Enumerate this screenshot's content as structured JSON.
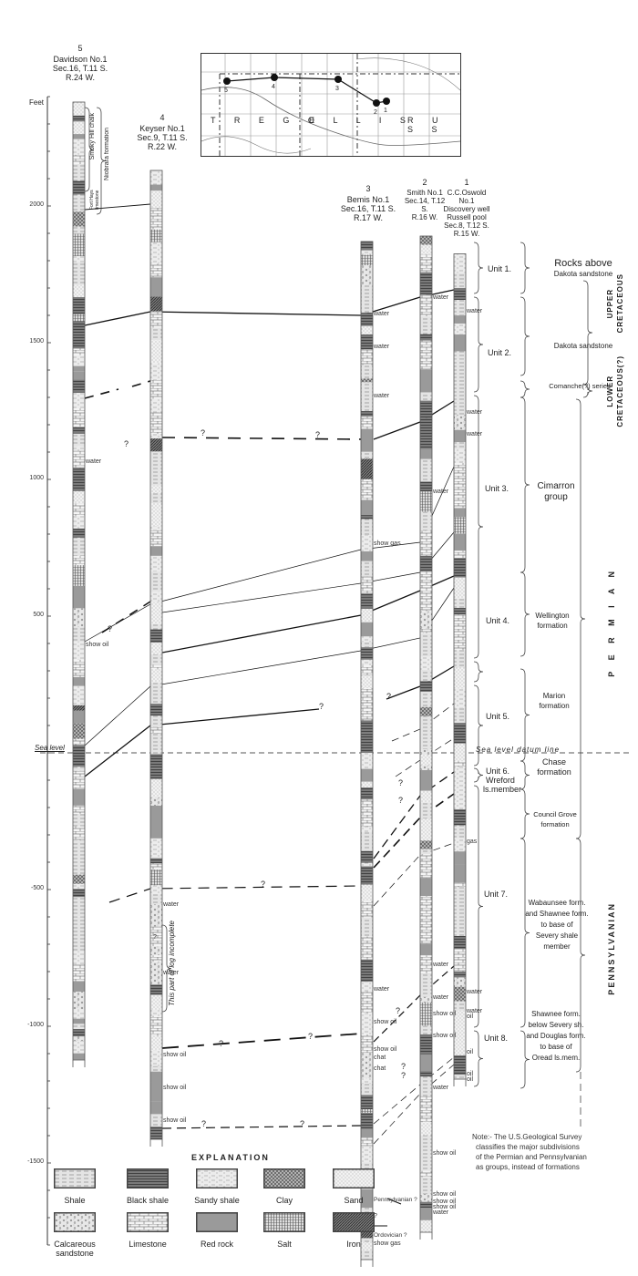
{
  "axis": {
    "unit_label": "Feet",
    "ticks": [
      {
        "value": 2000,
        "label": "2000"
      },
      {
        "value": 1500,
        "label": "1500"
      },
      {
        "value": 1000,
        "label": "1000"
      },
      {
        "value": 500,
        "label": "500"
      },
      {
        "value": 0,
        "label": "Sea level"
      },
      {
        "value": -500,
        "label": "-500"
      },
      {
        "value": -1000,
        "label": "-1000"
      },
      {
        "value": -1500,
        "label": "-1500"
      }
    ],
    "minor_step": 100
  },
  "datum": {
    "label": "Sea level datum line"
  },
  "wells": [
    {
      "id": "5",
      "name": "Davidson No.1",
      "lines": [
        "Sec.16, T.11 S.",
        "R.24 W."
      ],
      "top_ft": 2380,
      "bottom_ft": -1150
    },
    {
      "id": "4",
      "name": "Keyser No.1",
      "lines": [
        "Sec.9, T.11 S.",
        "R.22 W."
      ],
      "top_ft": 2130,
      "bottom_ft": -1440
    },
    {
      "id": "3",
      "name": "Bemis No.1",
      "lines": [
        "Sec.16, T.11 S.",
        "R.17 W."
      ],
      "top_ft": 1870,
      "bottom_ft": -1880
    },
    {
      "id": "2",
      "name": "Smith No.1",
      "lines": [
        "Sec.14, T.12 S.",
        "R.16 W."
      ],
      "top_ft": 1890,
      "bottom_ft": -1780
    },
    {
      "id": "1",
      "name": "C.C.Oswold No.1",
      "lines": [
        "Discovery well",
        "Russell pool",
        "Sec.8, T.12 S.",
        "R.15 W."
      ],
      "top_ft": 1825,
      "bottom_ft": -1220
    }
  ],
  "davidson_formations": [
    {
      "label": "Smoky Hill chalk"
    },
    {
      "label": "Fort Hays limestone"
    },
    {
      "label": "Niobrara formation"
    }
  ],
  "keyser_note": "This part of log incomplete",
  "well_annotations": [
    {
      "well": "5",
      "text": "water",
      "ft": 1060
    },
    {
      "well": "5",
      "text": "show oil",
      "ft": 390
    },
    {
      "well": "4",
      "text": "water",
      "ft": -560
    },
    {
      "well": "4",
      "text": "?",
      "ft": -680
    },
    {
      "well": "4",
      "text": "water",
      "ft": -810
    },
    {
      "well": "4",
      "text": "show oil",
      "ft": -1110
    },
    {
      "well": "4",
      "text": "show oil",
      "ft": -1230
    },
    {
      "well": "4",
      "text": "show oil",
      "ft": -1350
    },
    {
      "well": "3",
      "text": "water",
      "ft": 1600
    },
    {
      "well": "3",
      "text": "water",
      "ft": 1480
    },
    {
      "well": "3",
      "text": "water",
      "ft": 1300
    },
    {
      "well": "3",
      "text": "show gas",
      "ft": 760
    },
    {
      "well": "3",
      "text": "water",
      "ft": -870
    },
    {
      "well": "3",
      "text": "show oil",
      "ft": -990
    },
    {
      "well": "3",
      "text": "show oil",
      "ft": -1090
    },
    {
      "well": "3",
      "text": "chat",
      "ft": -1120
    },
    {
      "well": "3",
      "text": "chat",
      "ft": -1160
    },
    {
      "well": "3",
      "text": "Pennsylvanian ?",
      "ft": -1640
    },
    {
      "well": "3",
      "text": "?",
      "ft": -1700
    },
    {
      "well": "3",
      "text": "Ordovician ?",
      "ft": -1770
    },
    {
      "well": "3",
      "text": "show gas",
      "ft": -1800
    },
    {
      "well": "2",
      "text": "water",
      "ft": 1660
    },
    {
      "well": "2",
      "text": "water",
      "ft": 950
    },
    {
      "well": "2",
      "text": "water",
      "ft": -780
    },
    {
      "well": "2",
      "text": "water",
      "ft": -900
    },
    {
      "well": "2",
      "text": "show oil",
      "ft": -960
    },
    {
      "well": "2",
      "text": "show oil",
      "ft": -1040
    },
    {
      "well": "2",
      "text": "water",
      "ft": -1230
    },
    {
      "well": "2",
      "text": "show oil",
      "ft": -1470
    },
    {
      "well": "2",
      "text": "show oil",
      "ft": -1620
    },
    {
      "well": "2",
      "text": "show oil",
      "ft": -1645
    },
    {
      "well": "2",
      "text": "show oil",
      "ft": -1665
    },
    {
      "well": "2",
      "text": "water",
      "ft": -1685
    },
    {
      "well": "1",
      "text": "water",
      "ft": 1610
    },
    {
      "well": "1",
      "text": "water",
      "ft": 1240
    },
    {
      "well": "1",
      "text": "water",
      "ft": 1160
    },
    {
      "well": "1",
      "text": "gas",
      "ft": -330
    },
    {
      "well": "1",
      "text": "water",
      "ft": -880
    },
    {
      "well": "1",
      "text": "water",
      "ft": -950
    },
    {
      "well": "1",
      "text": "oil",
      "ft": -970
    },
    {
      "well": "1",
      "text": "oil",
      "ft": -1100
    },
    {
      "well": "1",
      "text": "oil",
      "ft": -1180
    },
    {
      "well": "1",
      "text": "oil",
      "ft": -1200
    }
  ],
  "units": [
    {
      "label": "Unit 1."
    },
    {
      "label": "Unit 2."
    },
    {
      "label": "Unit 3."
    },
    {
      "label": "Unit 4."
    },
    {
      "label": "Unit 5."
    },
    {
      "label": "Unit 6.",
      "sub": [
        "Wreford",
        "ls.member"
      ]
    },
    {
      "label": "Unit 7."
    },
    {
      "label": "Unit 8."
    }
  ],
  "formations": [
    {
      "lines": [
        "Rocks above",
        "Dakota sandstone"
      ]
    },
    {
      "lines": [
        "Dakota sandstone"
      ]
    },
    {
      "lines": [
        "Comanche(?) series"
      ]
    },
    {
      "lines": [
        "Cimarron",
        "group"
      ]
    },
    {
      "lines": [
        "Wellington",
        "formation"
      ]
    },
    {
      "lines": [
        "Marion",
        "formation"
      ]
    },
    {
      "lines": [
        "Chase",
        "formation"
      ]
    },
    {
      "lines": [
        "Council Grove",
        "formation"
      ]
    },
    {
      "lines": [
        "Wabaunsee form.",
        "and Shawnee form.",
        "to base of",
        "Severy shale",
        "member"
      ]
    },
    {
      "lines": [
        "Shawnee form.",
        "below Severy sh.",
        "and Douglas form.",
        "to base of",
        "Oread ls.mem."
      ]
    }
  ],
  "systems": [
    {
      "label": "UPPER CRETACEOUS",
      "lines": [
        "UPPER",
        "CRETACEOUS"
      ]
    },
    {
      "label": "LOWER CRETACEOUS(?)",
      "lines": [
        "LOWER",
        "CRETACEOUS(?)"
      ]
    },
    {
      "label": "PERMIAN",
      "lines": [
        "P E R M I A N"
      ]
    },
    {
      "label": "PENNSYLVANIAN",
      "lines": [
        "PENNSYLVANIAN"
      ]
    }
  ],
  "map": {
    "counties": [
      "T R E G O",
      "E L L I S",
      "R U S S"
    ],
    "well_points": [
      "5",
      "4",
      "3",
      "2",
      "1"
    ]
  },
  "legend": {
    "title": "EXPLANATION",
    "items": [
      {
        "key": "shale",
        "label": "Shale"
      },
      {
        "key": "black-shale",
        "label": "Black shale"
      },
      {
        "key": "sandy-shale",
        "label": "Sandy shale"
      },
      {
        "key": "clay",
        "label": "Clay"
      },
      {
        "key": "sand",
        "label": "Sand"
      },
      {
        "key": "calcareous-sandstone",
        "label": "Calcareous sandstone"
      },
      {
        "key": "limestone",
        "label": "Limestone"
      },
      {
        "key": "red-rock",
        "label": "Red rock"
      },
      {
        "key": "salt",
        "label": "Salt"
      },
      {
        "key": "iron",
        "label": "Iron"
      }
    ]
  },
  "note": {
    "lines": [
      "Note:- The U.S.Geological Survey",
      "classifies the major subdivisions",
      "of the Permian and Pennsylvanian",
      "as groups, instead of formations"
    ]
  },
  "question_mark": "?",
  "colors": {
    "ink": "#222222",
    "paper": "#ffffff",
    "shale": "#cfcfcf",
    "dark": "#555555"
  }
}
